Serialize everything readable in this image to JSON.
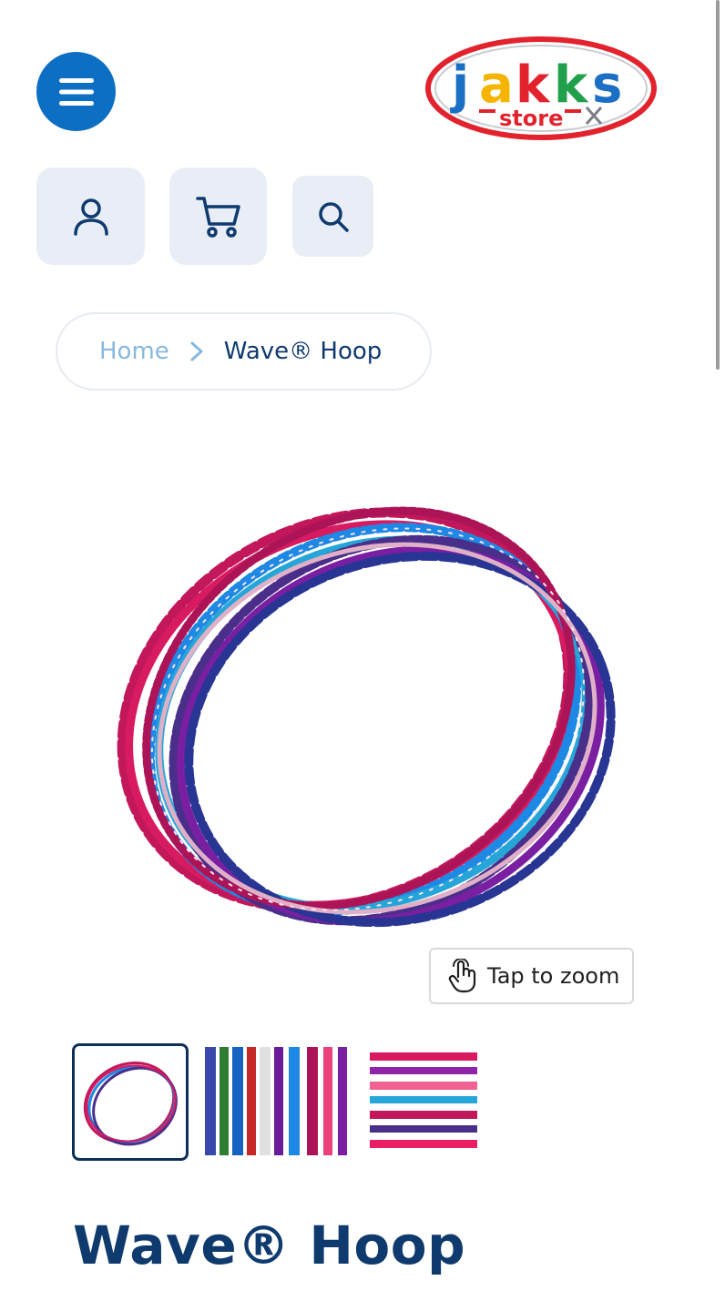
{
  "header": {
    "menu_icon": "hamburger-menu-icon",
    "logo": {
      "main": "jakks",
      "sub": "store",
      "colors": {
        "outline": "#e2222d",
        "j": "#1b6fc4",
        "a": "#f4b400",
        "k": "#e2222d",
        "k2": "#21a04b",
        "s": "#1b6fc4"
      }
    }
  },
  "toolbar": {
    "account_icon": "user-icon",
    "cart_icon": "shopping-cart-icon",
    "search_icon": "search-icon"
  },
  "breadcrumb": {
    "home": "Home",
    "separator_icon": "chevron-right-icon",
    "current": "Wave® Hoop"
  },
  "gallery": {
    "zoom_label": "Tap to zoom",
    "zoom_icon": "tap-hand-icon",
    "thumbnails": [
      "hoops-stack",
      "hoops-closeup",
      "hoops-side"
    ]
  },
  "product": {
    "title": "Wave® Hoop"
  },
  "colors": {
    "accent": "#0d6fc4",
    "navy": "#0e3a6e",
    "tool_bg": "#e9eef6",
    "breadcrumb_home": "#88b8de"
  }
}
